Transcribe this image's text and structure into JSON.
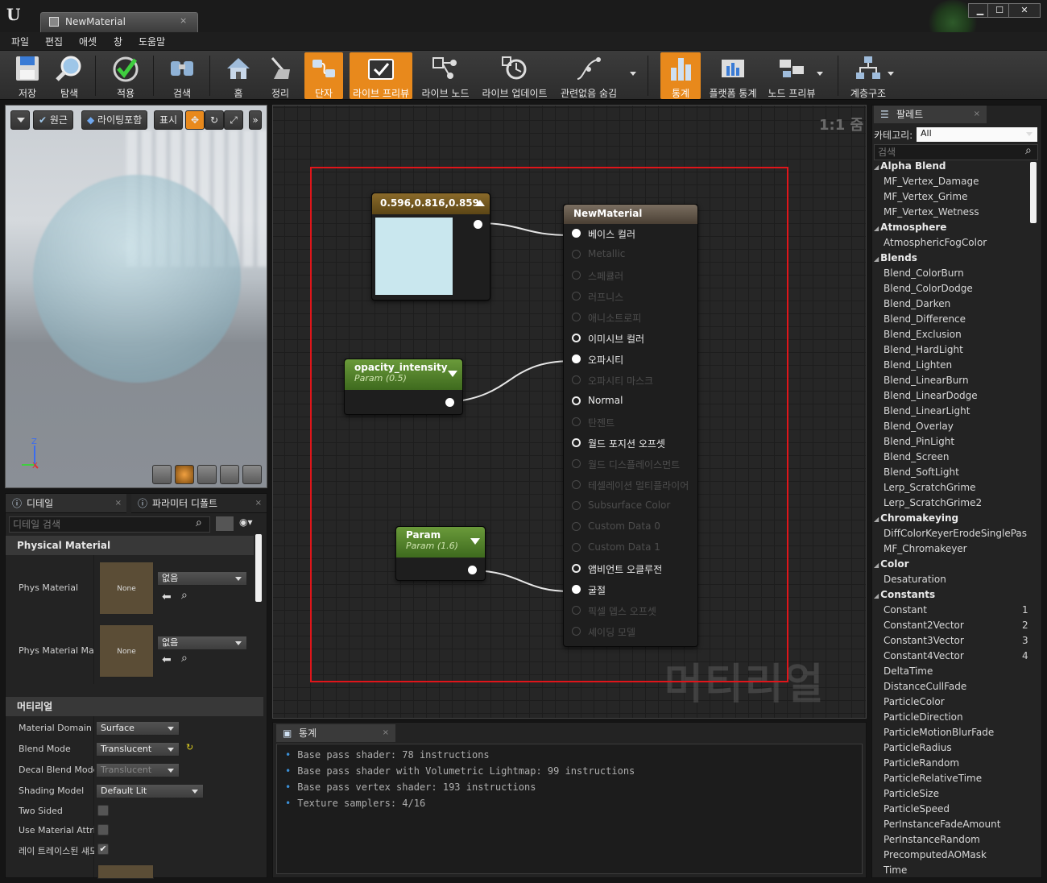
{
  "window": {
    "tab_title": "NewMaterial",
    "tab_close": "×",
    "minimize": "▁",
    "maximize": "☐",
    "close": "✕"
  },
  "menu": [
    "파일",
    "편집",
    "애셋",
    "창",
    "도움말"
  ],
  "toolbar": {
    "items": [
      {
        "label": "저장",
        "icon": "save-icon"
      },
      {
        "label": "탐색",
        "icon": "browse-icon"
      },
      {
        "label": "적용",
        "icon": "apply-icon"
      },
      {
        "label": "검색",
        "icon": "search-icon"
      },
      {
        "label": "홈",
        "icon": "home-icon"
      },
      {
        "label": "정리",
        "icon": "clean-up-icon"
      },
      {
        "label": "단자",
        "icon": "connectors-icon",
        "active": true
      },
      {
        "label": "라이브 프리뷰",
        "icon": "live-preview-icon",
        "active": true
      },
      {
        "label": "라이브 노드",
        "icon": "live-nodes-icon"
      },
      {
        "label": "라이브 업데이트",
        "icon": "live-update-icon"
      },
      {
        "label": "관련없음 숨김",
        "icon": "hide-unrelated-icon"
      },
      {
        "label": "통계",
        "icon": "stats-icon",
        "active": true
      },
      {
        "label": "플랫폼 통계",
        "icon": "platform-stats-icon"
      },
      {
        "label": "노드 프리뷰",
        "icon": "node-preview-icon"
      },
      {
        "label": "계층구조",
        "icon": "hierarchy-icon"
      }
    ]
  },
  "viewport": {
    "perspective": "원근",
    "lighting": "라이팅포함",
    "show": "표시",
    "axis_z": "Z",
    "axis_x": "X"
  },
  "details": {
    "tab1": "디테일",
    "tab2": "파라미터 디폴트",
    "search_placeholder": "디테일 검색",
    "physical_material_category": "Physical Material",
    "phys_material_label": "Phys Material",
    "phys_material_mask_label": "Phys Material Mas",
    "thumb_none": "None",
    "none_option": "없음",
    "material_category": "머티리얼",
    "rows": [
      {
        "label": "Material Domain",
        "value": "Surface"
      },
      {
        "label": "Blend Mode",
        "value": "Translucent"
      },
      {
        "label": "Decal Blend Mode",
        "value": "Translucent"
      },
      {
        "label": "Shading Model",
        "value": "Default Lit"
      },
      {
        "label": "Two Sided",
        "value": ""
      },
      {
        "label": "Use Material Attri",
        "value": ""
      },
      {
        "label": "레이 트레이스된 섀도",
        "value": ""
      }
    ],
    "reset_icon": "↻"
  },
  "graph": {
    "zoom": "1:1 줌",
    "watermark": "머티리얼",
    "color_node": {
      "title": "0.596,0.816,0.859",
      "color": "#c9e7ee"
    },
    "opacity_node": {
      "title": "opacity_intensity",
      "subtitle": "Param (0.5)"
    },
    "param_node": {
      "title": "Param",
      "subtitle": "Param (1.6)"
    },
    "material_node": {
      "title": "NewMaterial",
      "pins": [
        {
          "label": "베이스 컬러",
          "state": "connected"
        },
        {
          "label": "Metallic",
          "state": "disabled"
        },
        {
          "label": "스페큘러",
          "state": "disabled"
        },
        {
          "label": "러프니스",
          "state": "disabled"
        },
        {
          "label": "애니소트로피",
          "state": "disabled"
        },
        {
          "label": "이미시브 컬러",
          "state": "enabled"
        },
        {
          "label": "오파시티",
          "state": "connected"
        },
        {
          "label": "오파시티 마스크",
          "state": "disabled"
        },
        {
          "label": "Normal",
          "state": "enabled"
        },
        {
          "label": "탄젠트",
          "state": "disabled"
        },
        {
          "label": "월드 포지션 오프셋",
          "state": "enabled"
        },
        {
          "label": "월드 디스플레이스먼트",
          "state": "disabled"
        },
        {
          "label": "테셀레이션 멀티플라이어",
          "state": "disabled"
        },
        {
          "label": "Subsurface Color",
          "state": "disabled"
        },
        {
          "label": "Custom Data 0",
          "state": "disabled"
        },
        {
          "label": "Custom Data 1",
          "state": "disabled"
        },
        {
          "label": "앰비언트 오클루전",
          "state": "enabled"
        },
        {
          "label": "굴절",
          "state": "connected"
        },
        {
          "label": "픽셀 뎁스 오프셋",
          "state": "disabled"
        },
        {
          "label": "셰이딩 모델",
          "state": "disabled"
        }
      ]
    }
  },
  "stats": {
    "tab": "통계",
    "lines": [
      "Base pass shader: 78 instructions",
      "Base pass shader with Volumetric Lightmap: 99 instructions",
      "Base pass vertex shader: 193 instructions",
      "Texture samplers: 4/16"
    ]
  },
  "palette": {
    "tab": "팔레트",
    "category_label": "카테고리:",
    "category_value": "All",
    "search_placeholder": "검색",
    "entries": [
      {
        "type": "cat",
        "text": "Alpha Blend"
      },
      {
        "type": "item",
        "text": "MF_Vertex_Damage"
      },
      {
        "type": "item",
        "text": "MF_Vertex_Grime"
      },
      {
        "type": "item",
        "text": "MF_Vertex_Wetness"
      },
      {
        "type": "cat",
        "text": "Atmosphere"
      },
      {
        "type": "item",
        "text": "AtmosphericFogColor"
      },
      {
        "type": "cat",
        "text": "Blends"
      },
      {
        "type": "item",
        "text": "Blend_ColorBurn"
      },
      {
        "type": "item",
        "text": "Blend_ColorDodge"
      },
      {
        "type": "item",
        "text": "Blend_Darken"
      },
      {
        "type": "item",
        "text": "Blend_Difference"
      },
      {
        "type": "item",
        "text": "Blend_Exclusion"
      },
      {
        "type": "item",
        "text": "Blend_HardLight"
      },
      {
        "type": "item",
        "text": "Blend_Lighten"
      },
      {
        "type": "item",
        "text": "Blend_LinearBurn"
      },
      {
        "type": "item",
        "text": "Blend_LinearDodge"
      },
      {
        "type": "item",
        "text": "Blend_LinearLight"
      },
      {
        "type": "item",
        "text": "Blend_Overlay"
      },
      {
        "type": "item",
        "text": "Blend_PinLight"
      },
      {
        "type": "item",
        "text": "Blend_Screen"
      },
      {
        "type": "item",
        "text": "Blend_SoftLight"
      },
      {
        "type": "item",
        "text": "Lerp_ScratchGrime"
      },
      {
        "type": "item",
        "text": "Lerp_ScratchGrime2"
      },
      {
        "type": "cat",
        "text": "Chromakeying"
      },
      {
        "type": "item",
        "text": "DiffColorKeyerErodeSinglePas"
      },
      {
        "type": "item",
        "text": "MF_Chromakeyer"
      },
      {
        "type": "cat",
        "text": "Color"
      },
      {
        "type": "item",
        "text": "Desaturation"
      },
      {
        "type": "cat",
        "text": "Constants"
      },
      {
        "type": "item",
        "text": "Constant",
        "num": "1"
      },
      {
        "type": "item",
        "text": "Constant2Vector",
        "num": "2"
      },
      {
        "type": "item",
        "text": "Constant3Vector",
        "num": "3"
      },
      {
        "type": "item",
        "text": "Constant4Vector",
        "num": "4"
      },
      {
        "type": "item",
        "text": "DeltaTime"
      },
      {
        "type": "item",
        "text": "DistanceCullFade"
      },
      {
        "type": "item",
        "text": "ParticleColor"
      },
      {
        "type": "item",
        "text": "ParticleDirection"
      },
      {
        "type": "item",
        "text": "ParticleMotionBlurFade"
      },
      {
        "type": "item",
        "text": "ParticleRadius"
      },
      {
        "type": "item",
        "text": "ParticleRandom"
      },
      {
        "type": "item",
        "text": "ParticleRelativeTime"
      },
      {
        "type": "item",
        "text": "ParticleSize"
      },
      {
        "type": "item",
        "text": "ParticleSpeed"
      },
      {
        "type": "item",
        "text": "PerInstanceFadeAmount"
      },
      {
        "type": "item",
        "text": "PerInstanceRandom"
      },
      {
        "type": "item",
        "text": "PrecomputedAOMask"
      },
      {
        "type": "item",
        "text": "Time"
      }
    ]
  }
}
